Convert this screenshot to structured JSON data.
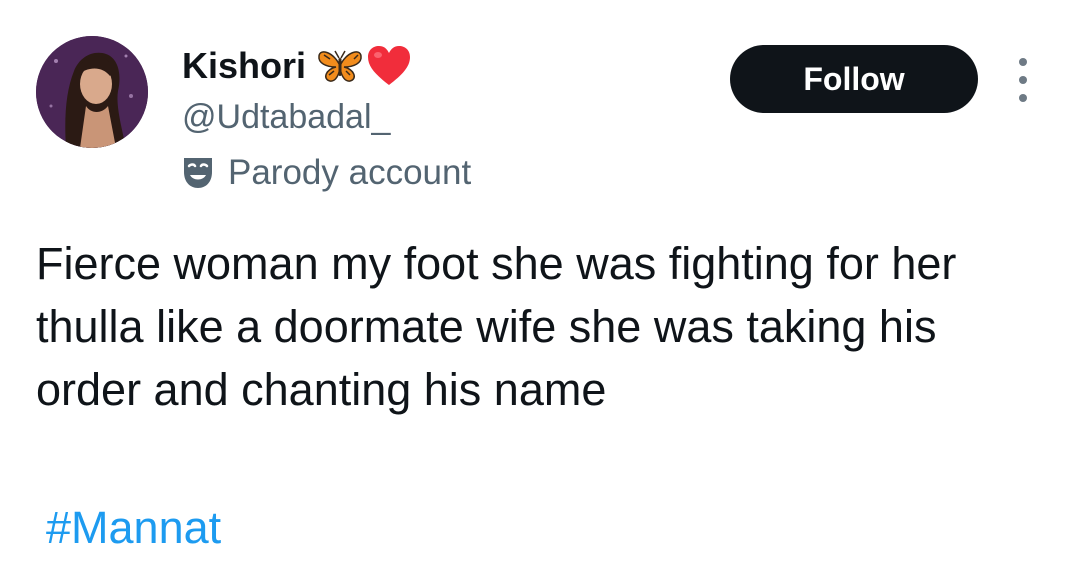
{
  "author": {
    "display_name": "Kishori",
    "name_emoji": [
      "butterfly-icon",
      "red-heart-icon"
    ],
    "handle": "@Udtabadal_",
    "label": "Parody account",
    "label_icon": "theater-mask-icon"
  },
  "actions": {
    "follow_label": "Follow",
    "more_icon": "more-vertical-icon"
  },
  "tweet": {
    "text": "Fierce woman my foot she was fighting for her thulla like a doormate wife she was taking his order and chanting his name",
    "hashtag": "#Mannat"
  },
  "colors": {
    "text_primary": "#0f1419",
    "text_secondary": "#536471",
    "link": "#1d9bf0",
    "follow_bg": "#0f1419",
    "follow_fg": "#ffffff"
  }
}
